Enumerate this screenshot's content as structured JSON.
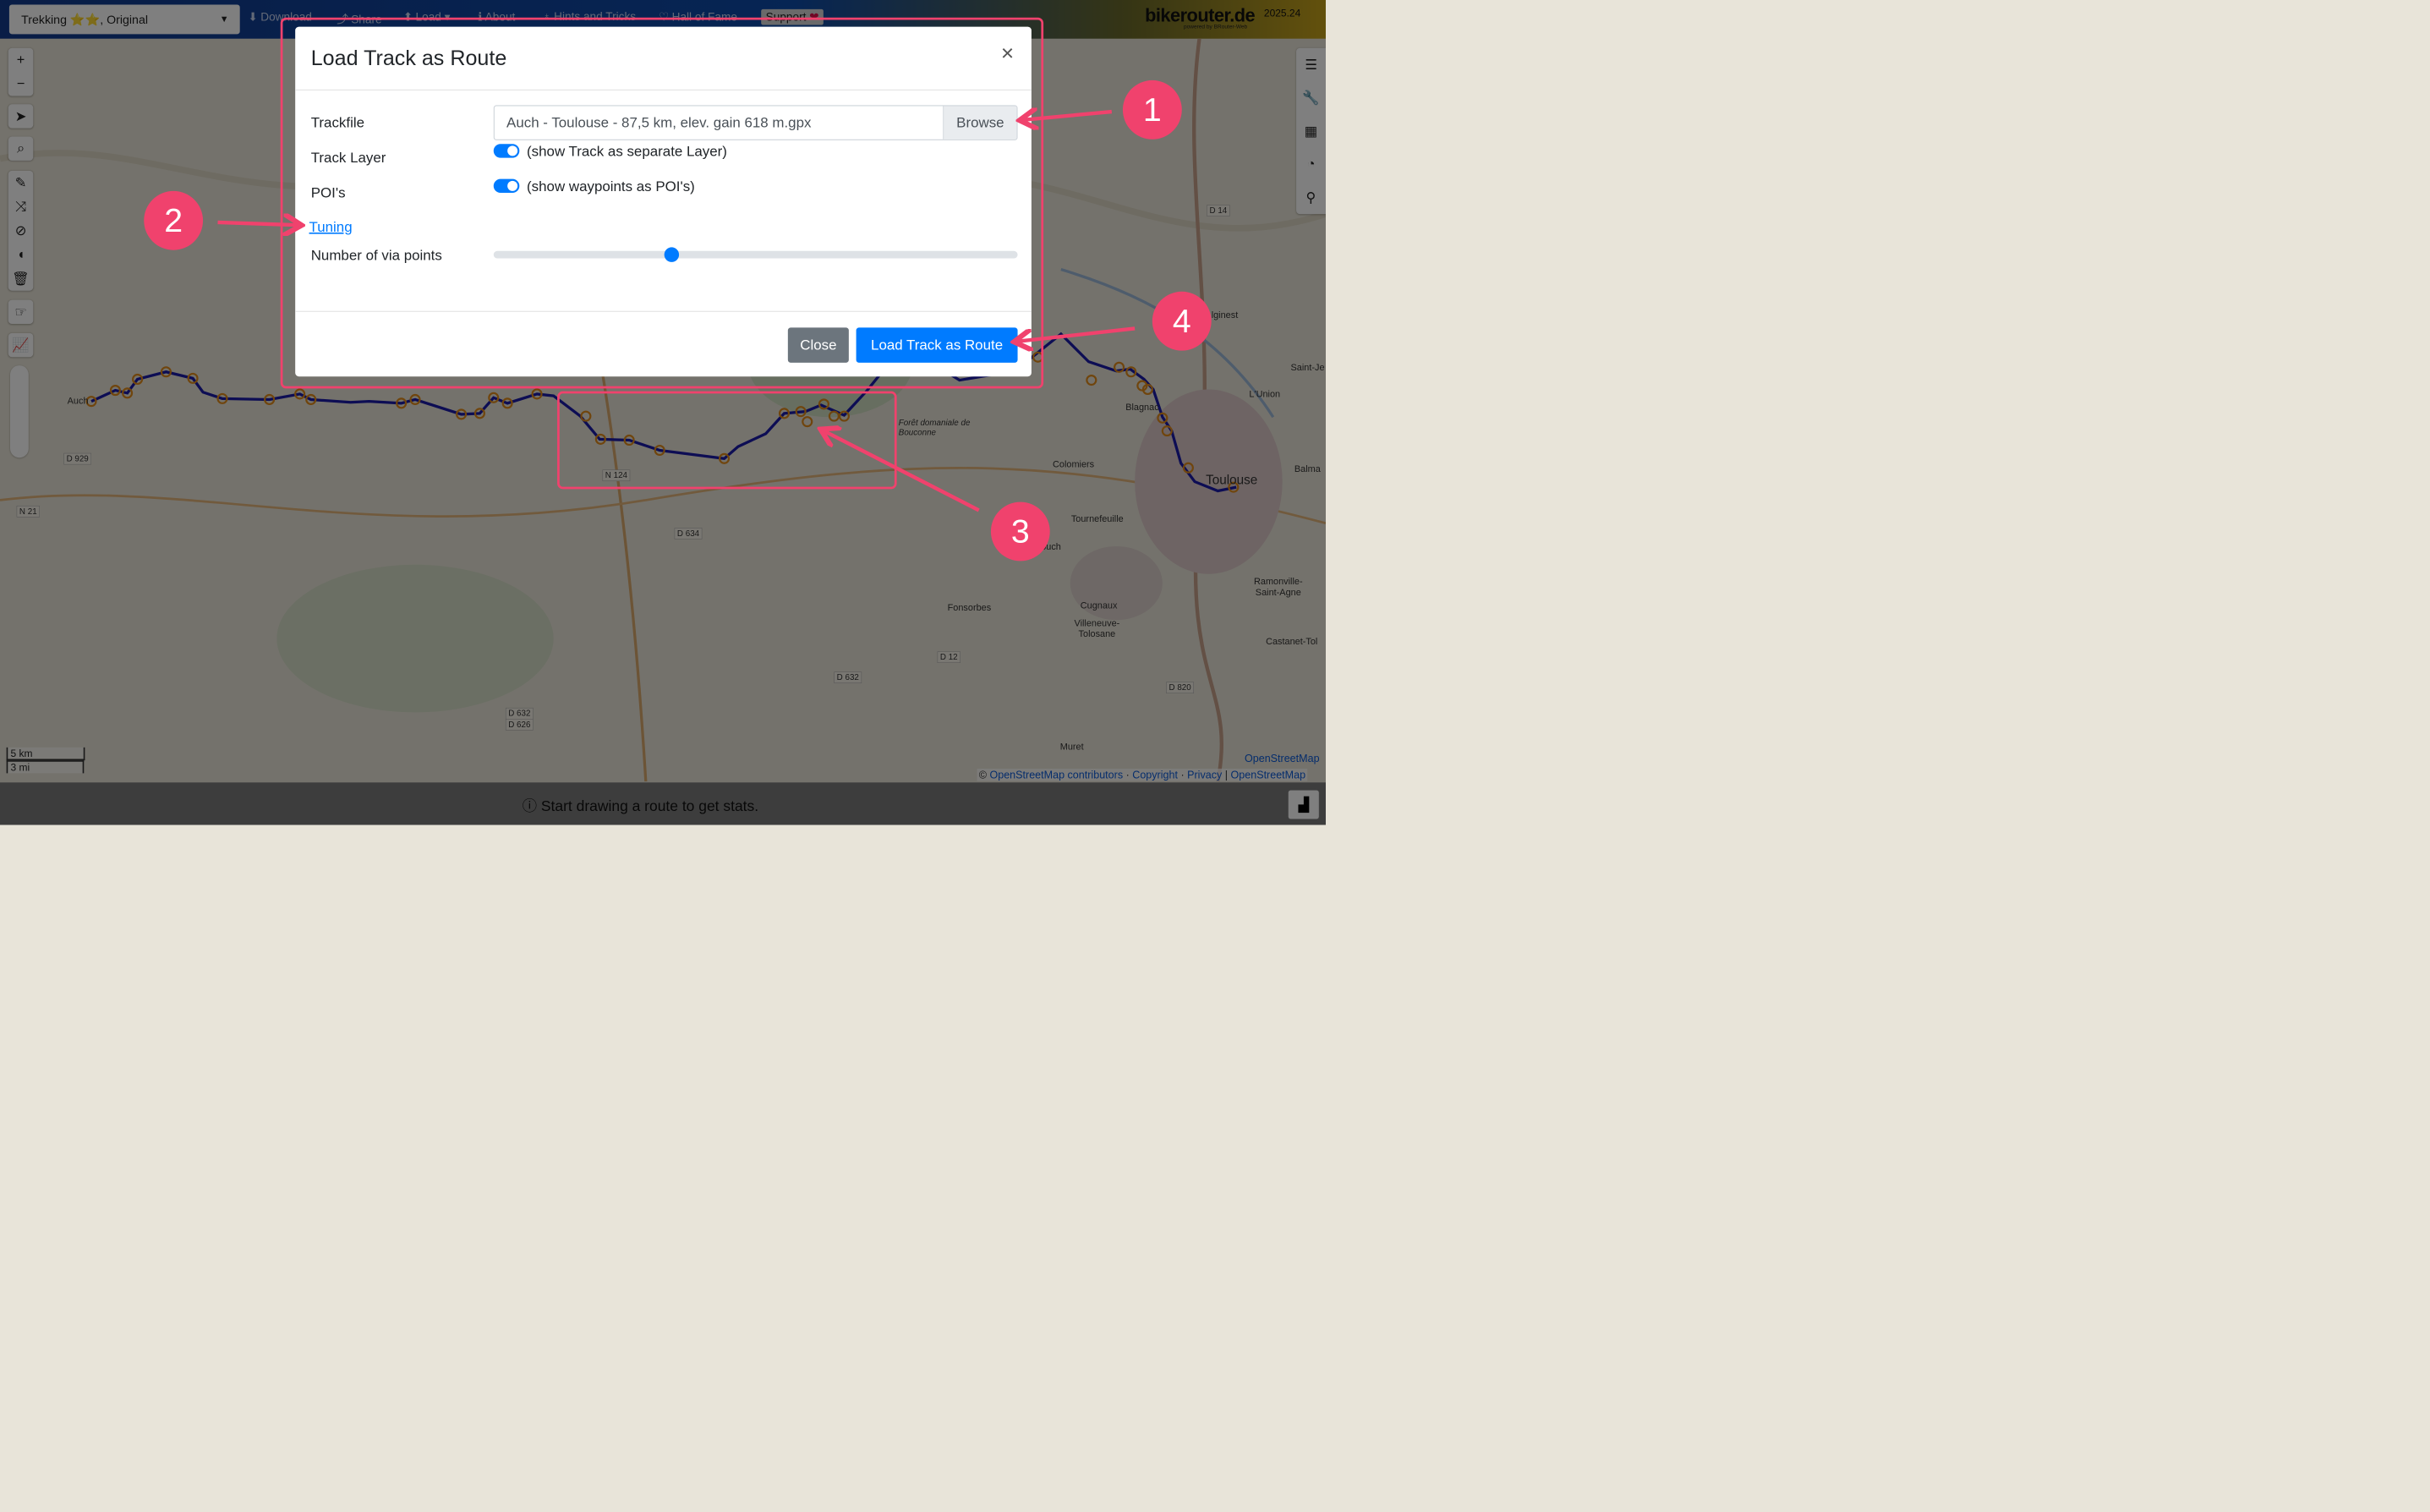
{
  "topbar": {
    "profile": "Trekking ⭐⭐, Original",
    "nav": {
      "download": "Download",
      "share": "Share",
      "load": "Load",
      "about": "About",
      "hints": "Hints and Tricks",
      "hall": "Hall of Fame",
      "support": "Support"
    },
    "brand": "bikerouter.de",
    "brand_sub": "powered by BRouter-Web",
    "version": "2025.24"
  },
  "map": {
    "labels": {
      "auch": "Auch",
      "toulouse": "Toulouse",
      "colomiers": "Colomiers",
      "tournefeuille": "Tournefeuille",
      "blagnac": "Blagnac",
      "fonsorbes": "Fonsorbes",
      "cugnaux": "Cugnaux",
      "villeneuve": "Villeneuve-Tolosane",
      "ramonville": "Ramonville-Saint-Agne",
      "balma": "Balma",
      "lunion": "L'Union",
      "muret": "Muret",
      "castanet": "Castanet-Tol",
      "saintje": "Saint-Je",
      "foret": "Forêt domaniale de Bouconne",
      "iginest": "lginest",
      "touch": "e-du-Touch"
    },
    "roads": {
      "d929": "D 929",
      "n21": "N 21",
      "n124": "N 124",
      "d634": "D 634",
      "d12": "D 12",
      "d632": "D 632",
      "d632b": "D 632",
      "d626": "D 626",
      "d820": "D 820",
      "d14": "D 14"
    }
  },
  "scale": {
    "km": "5 km",
    "mi": "3 mi"
  },
  "attribution": {
    "osm_top": "OpenStreetMap",
    "prefix": "©",
    "contributors": "OpenStreetMap contributors",
    "sep1": "·",
    "copyright": "Copyright",
    "sep2": "·",
    "privacy": "Privacy",
    "sep3": "|",
    "osm": "OpenStreetMap"
  },
  "bottombar": {
    "message": "Start drawing a route to get stats."
  },
  "modal": {
    "title": "Load Track as Route",
    "close_symbol": "×",
    "trackfile_label": "Trackfile",
    "file_value": "Auch - Toulouse - 87,5 km, elev. gain 618 m.gpx",
    "browse_label": "Browse",
    "track_layer_label": "Track Layer",
    "track_layer_text": "(show Track as separate Layer)",
    "track_layer_on": true,
    "pois_label": "POI's",
    "pois_text": "(show waypoints as POI's)",
    "pois_on": true,
    "tuning_label": "Tuning",
    "via_label": "Number of via points",
    "via_slider_fraction": 0.34,
    "close_button": "Close",
    "load_button": "Load Track as Route"
  },
  "annotations": {
    "one": "1",
    "two": "2",
    "three": "3",
    "four": "4"
  },
  "colors": {
    "accent": "#f0426d",
    "primary": "#007bff",
    "secondary": "#6c757d",
    "route": "#1a1aa8"
  }
}
